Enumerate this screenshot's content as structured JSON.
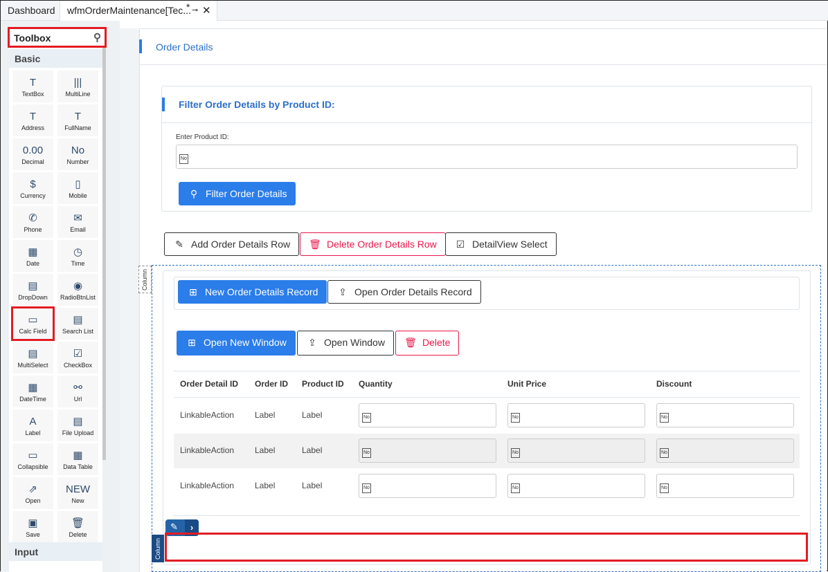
{
  "tabs": [
    {
      "label": "Dashboard"
    },
    {
      "label": "wfmOrderMaintenance[Tec...",
      "modified": "*"
    }
  ],
  "toolbox": {
    "title": "Toolbox",
    "sections": [
      "Basic",
      "Input"
    ],
    "items": [
      {
        "label": "TextBox",
        "icon": "T"
      },
      {
        "label": "MultiLine",
        "icon": "|||"
      },
      {
        "label": "Address",
        "icon": "T"
      },
      {
        "label": "FullName",
        "icon": "T"
      },
      {
        "label": "Decimal",
        "icon": "0.00"
      },
      {
        "label": "Number",
        "icon": "No"
      },
      {
        "label": "Currency",
        "icon": "$"
      },
      {
        "label": "Mobile",
        "icon": "▯"
      },
      {
        "label": "Phone",
        "icon": "✆"
      },
      {
        "label": "Email",
        "icon": "✉"
      },
      {
        "label": "Date",
        "icon": "▦"
      },
      {
        "label": "Time",
        "icon": "◷"
      },
      {
        "label": "DropDown",
        "icon": "▤"
      },
      {
        "label": "RadioBtnList",
        "icon": "◉"
      },
      {
        "label": "Calc Field",
        "icon": "▭"
      },
      {
        "label": "Search List",
        "icon": "▤"
      },
      {
        "label": "MultiSelect",
        "icon": "▤"
      },
      {
        "label": "CheckBox",
        "icon": "☑"
      },
      {
        "label": "DateTime",
        "icon": "▦"
      },
      {
        "label": "Url",
        "icon": "⚯"
      },
      {
        "label": "Label",
        "icon": "A"
      },
      {
        "label": "File Upload",
        "icon": "▤"
      },
      {
        "label": "Collapsible",
        "icon": "▭"
      },
      {
        "label": "Data Table",
        "icon": "▦"
      },
      {
        "label": "Open",
        "icon": "⇗"
      },
      {
        "label": "New",
        "icon": "NEW"
      },
      {
        "label": "Save",
        "icon": "▣"
      },
      {
        "label": "Delete",
        "icon": "🗑"
      }
    ]
  },
  "page": {
    "title": "Order Details",
    "filter": {
      "title": "Filter Order Details by Product ID:",
      "label": "Enter Product ID:",
      "input_icon": "No",
      "button": "Filter Order Details"
    },
    "actions": [
      "Add Order Details Row",
      "Delete Order Details Row",
      "DetailView Select"
    ],
    "column_label": "Column",
    "record_buttons": [
      "New Order Details Record",
      "Open Order Details Record"
    ],
    "window_buttons": [
      "Open New Window",
      "Open Window",
      "Delete"
    ],
    "table": {
      "headers": [
        "Order Detail ID",
        "Order ID",
        "Product ID",
        "Quantity",
        "Unit Price",
        "Discount"
      ],
      "rows": [
        [
          "LinkableAction",
          "Label",
          "Label",
          "No",
          "No",
          "No"
        ],
        [
          "LinkableAction",
          "Label",
          "Label",
          "No",
          "No",
          "No"
        ],
        [
          "LinkableAction",
          "Label",
          "Label",
          "No",
          "No",
          "No"
        ]
      ]
    }
  }
}
